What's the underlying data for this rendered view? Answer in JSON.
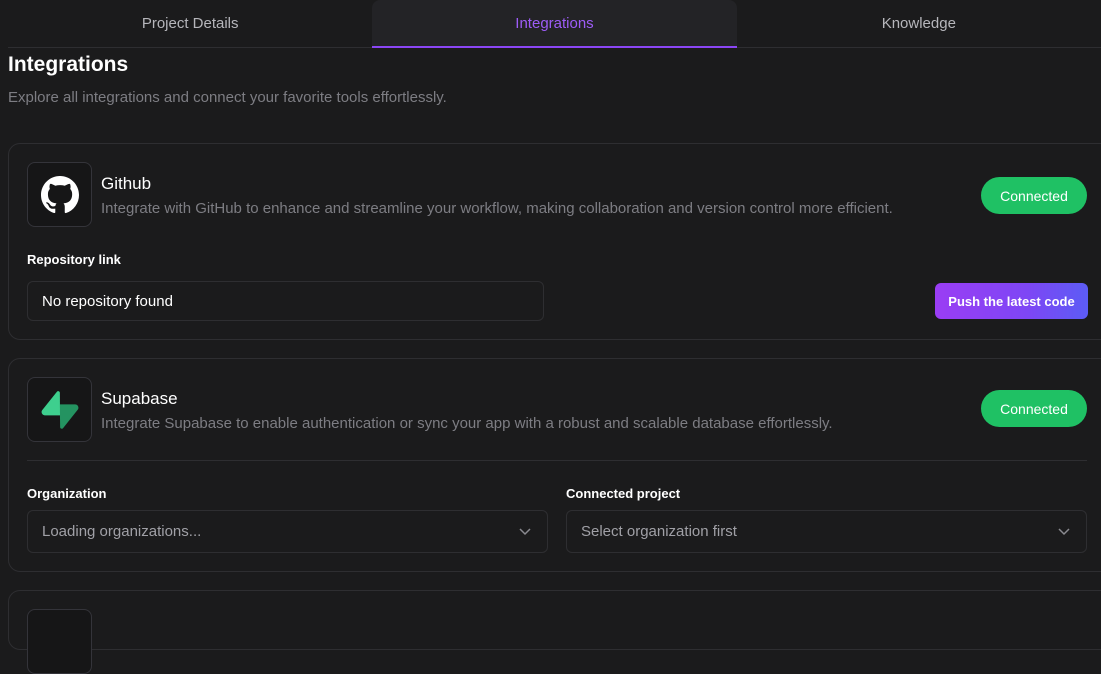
{
  "tabs": [
    {
      "label": "Project Details"
    },
    {
      "label": "Integrations"
    },
    {
      "label": "Knowledge"
    }
  ],
  "page": {
    "title": "Integrations",
    "subtitle": "Explore all integrations and connect your favorite tools effortlessly."
  },
  "github": {
    "icon": "github-icon",
    "title": "Github",
    "description": "Integrate with GitHub to enhance and streamline your workflow, making collaboration and version control more efficient.",
    "status": "Connected",
    "repo_label": "Repository link",
    "repo_value": "No repository found",
    "push_label": "Push the latest code"
  },
  "supabase": {
    "icon": "supabase-icon",
    "title": "Supabase",
    "description": "Integrate Supabase to enable authentication or sync your app with a robust and scalable database effortlessly.",
    "status": "Connected",
    "org_label": "Organization",
    "org_value": "Loading organizations...",
    "project_label": "Connected project",
    "project_value": "Select organization first"
  },
  "colors": {
    "accent": "#8b46f5",
    "connected": "#1fc164",
    "background": "#1b1b1c"
  }
}
